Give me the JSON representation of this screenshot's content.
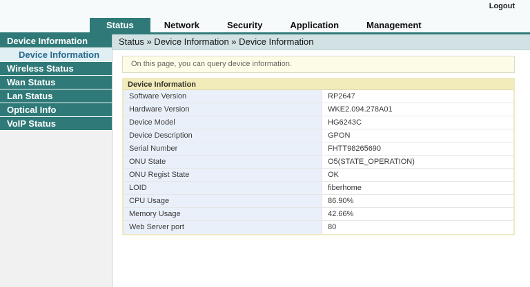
{
  "colors": {
    "teal_accent": "#2f7a78",
    "breadcrumb_bg": "#d2e2e4",
    "notice_bg": "#fdfce6",
    "table_header_bg": "#f2ecba",
    "table_label_bg": "#eaf0f9",
    "sidebar_active_bg": "#e0eff4",
    "sidebar_active_text": "#26698e"
  },
  "header": {
    "logout_label": "Logout"
  },
  "nav": {
    "tabs": [
      {
        "label": "Status",
        "active": true
      },
      {
        "label": "Network",
        "active": false
      },
      {
        "label": "Security",
        "active": false
      },
      {
        "label": "Application",
        "active": false
      },
      {
        "label": "Management",
        "active": false
      }
    ]
  },
  "sidebar": {
    "items": [
      {
        "label": "Device Information",
        "type": "section",
        "active": false
      },
      {
        "label": "Device Information",
        "type": "sub",
        "active": true
      },
      {
        "label": "Wireless Status",
        "type": "section",
        "active": false
      },
      {
        "label": "Wan Status",
        "type": "section",
        "active": false
      },
      {
        "label": "Lan Status",
        "type": "section",
        "active": false
      },
      {
        "label": "Optical Info",
        "type": "section",
        "active": false
      },
      {
        "label": "VoIP Status",
        "type": "section",
        "active": false
      }
    ]
  },
  "breadcrumb": {
    "text": "Status » Device Information » Device Information"
  },
  "notice": {
    "text": "On this page, you can query device information."
  },
  "table": {
    "title": "Device Information",
    "rows": [
      {
        "label": "Software Version",
        "value": "RP2647"
      },
      {
        "label": "Hardware Version",
        "value": "WKE2.094.278A01"
      },
      {
        "label": "Device Model",
        "value": "HG6243C"
      },
      {
        "label": "Device Description",
        "value": "GPON"
      },
      {
        "label": "Serial Number",
        "value": "FHTT98265690"
      },
      {
        "label": "ONU State",
        "value": "O5(STATE_OPERATION)"
      },
      {
        "label": "ONU Regist State",
        "value": "OK"
      },
      {
        "label": "LOID",
        "value": "fiberhome"
      },
      {
        "label": "CPU Usage",
        "value": "86.90%"
      },
      {
        "label": "Memory Usage",
        "value": "42.66%"
      },
      {
        "label": "Web Server port",
        "value": "80"
      }
    ]
  }
}
